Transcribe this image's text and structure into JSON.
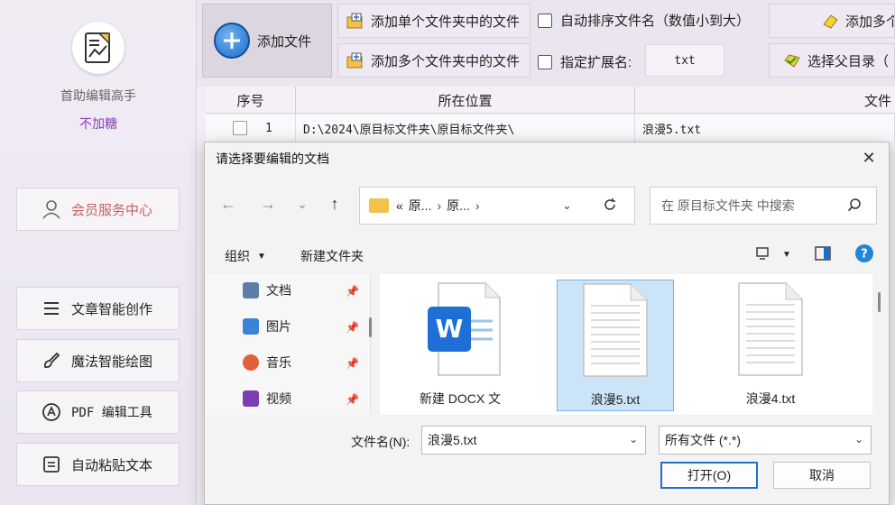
{
  "sidebar": {
    "app_name": "首助编辑高手",
    "app_sub": "不加糖",
    "member_label": "会员服务中心",
    "items": [
      {
        "label": "文章智能创作",
        "icon": "list-icon"
      },
      {
        "label": "魔法智能绘图",
        "icon": "brush-icon"
      },
      {
        "label": "PDF 编辑工具",
        "icon": "pdf-icon"
      },
      {
        "label": "自动粘贴文本",
        "icon": "paste-icon"
      }
    ]
  },
  "toolbar": {
    "add_file": "添加文件",
    "add_single_folder": "添加单个文件夹中的文件",
    "add_multi_folder": "添加多个文件夹中的文件",
    "auto_sort": "自动排序文件名（数值小到大）",
    "specify_ext": "指定扩展名:",
    "ext_value": "txt",
    "add_multi_right": "添加多个",
    "choose_parent": "选择父目录（"
  },
  "table": {
    "headers": [
      "序号",
      "所在位置",
      "文件"
    ],
    "rows": [
      {
        "index": "1",
        "location": "D:\\2024\\原目标文件夹\\原目标文件夹\\",
        "file": "浪漫5.txt"
      }
    ]
  },
  "dialog": {
    "title": "请选择要编辑的文档",
    "address_segments": [
      "«",
      "原...",
      "›",
      "原...",
      "›"
    ],
    "search_placeholder": "在 原目标文件夹 中搜索",
    "organize": "组织",
    "new_folder": "新建文件夹",
    "nav_items": [
      {
        "label": "文档",
        "color": "#5b7ea8"
      },
      {
        "label": "图片",
        "color": "#3a84d6"
      },
      {
        "label": "音乐",
        "color": "#e0603a"
      },
      {
        "label": "视频",
        "color": "#7a3fb5"
      }
    ],
    "files": [
      {
        "name": "新建 DOCX 文",
        "type": "word"
      },
      {
        "name": "浪漫5.txt",
        "type": "txt",
        "selected": true
      },
      {
        "name": "浪漫4.txt",
        "type": "txt"
      }
    ],
    "filename_label": "文件名(N):",
    "filename_value": "浪漫5.txt",
    "filter_value": "所有文件 (*.*)",
    "open_label": "打开(O)",
    "cancel_label": "取消"
  },
  "colors": {
    "accent": "#1f6fc7",
    "sidebar_bg": "#f1ecf4",
    "sub_purple": "#8a3fb5",
    "member_red": "#c46262",
    "selected_file_bg": "#cce4f7"
  }
}
